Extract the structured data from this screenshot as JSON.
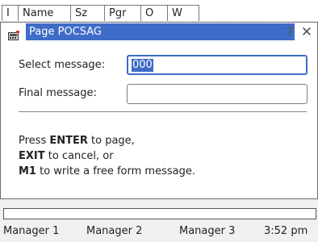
{
  "background_table": {
    "columns": [
      "I",
      "Name",
      "Sz",
      "Pgr",
      "O",
      "W"
    ]
  },
  "dialog": {
    "app_icon": "pager-icon",
    "title": "Page POCSAG",
    "help_label": "?",
    "close_label": "✕",
    "select_label": "Select message:",
    "select_value": "000",
    "final_label": "Final message:",
    "final_value": "",
    "instructions": [
      {
        "bold": "",
        "text": "Press "
      },
      {
        "bold": "ENTER",
        "text": " to page,"
      },
      {
        "bold": "EXIT",
        "text": " to cancel, or"
      },
      {
        "bold": "M1",
        "text": " to write a free form message."
      }
    ],
    "instr_line1_pre": "Press ",
    "instr_line1_bold": "ENTER",
    "instr_line1_post": " to page,",
    "instr_line2_bold": "EXIT",
    "instr_line2_post": " to cancel, or",
    "instr_line3_bold": "M1",
    "instr_line3_post": " to write a free form message."
  },
  "taskbar": {
    "items": [
      "Manager 1",
      "Manager 2",
      "Manager 3"
    ],
    "clock": "3:52 pm"
  },
  "colors": {
    "accent": "#3e6cc8",
    "background": "#e8e8e8"
  }
}
